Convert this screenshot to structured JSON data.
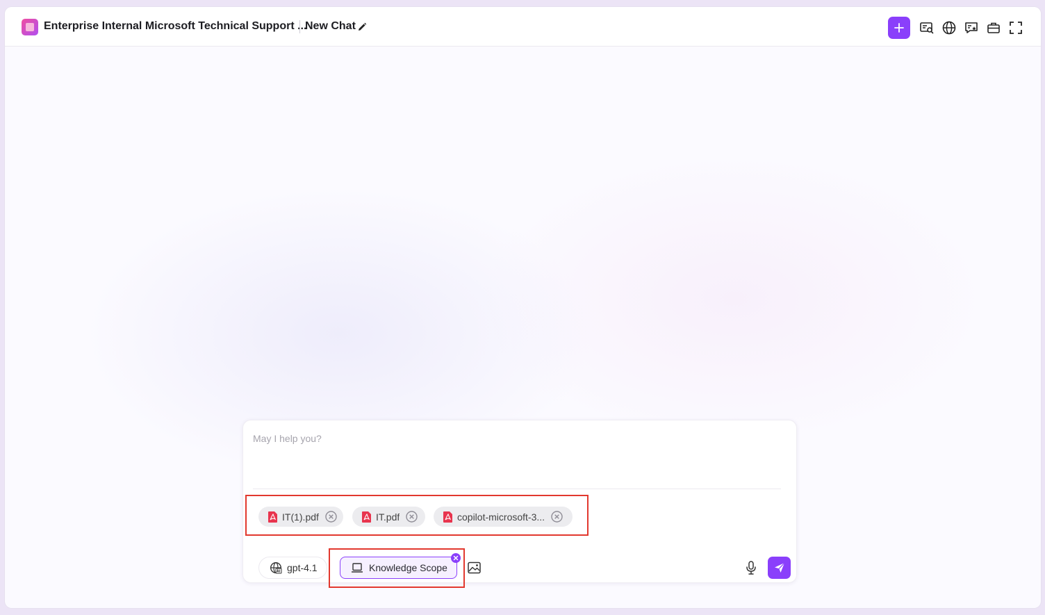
{
  "header": {
    "app_title": "Enterprise Internal Microsoft Technical Support ...",
    "chat_title": "New Chat"
  },
  "composer": {
    "placeholder": "May I help you?",
    "attachments": [
      {
        "name": "IT(1).pdf"
      },
      {
        "name": "IT.pdf"
      },
      {
        "name": "copilot-microsoft-3..."
      }
    ],
    "model": "gpt-4.1",
    "knowledge_scope": "Knowledge Scope"
  },
  "colors": {
    "accent": "#8a3ffb",
    "highlight_box": "#e2382e",
    "pdf_icon": "#e8344e"
  },
  "icons": {
    "toolbar": [
      "new-chat-plus-icon",
      "search-chat-icon",
      "globe-icon",
      "chat-star-icon",
      "briefcase-icon",
      "fullscreen-icon"
    ],
    "composer": [
      "pdf-icon",
      "close-circle-icon",
      "model-globe-icon",
      "laptop-icon",
      "image-icon",
      "microphone-icon",
      "send-icon"
    ]
  }
}
